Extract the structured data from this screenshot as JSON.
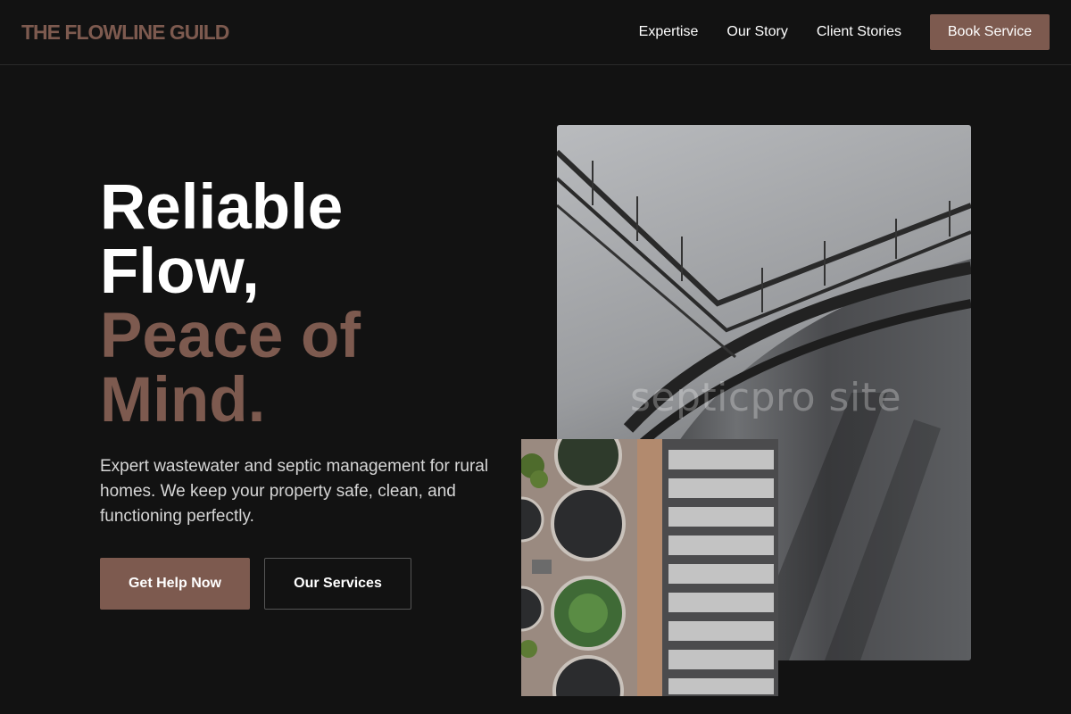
{
  "brand": {
    "logo_text": "THE FLOWLINE GUILD",
    "accent_color": "#7d5a4f"
  },
  "nav": {
    "items": [
      {
        "label": "Expertise"
      },
      {
        "label": "Our Story"
      },
      {
        "label": "Client Stories"
      }
    ],
    "cta_label": "Book Service"
  },
  "hero": {
    "title_line1": "Reliable",
    "title_line2": "Flow,",
    "title_line3": "Peace of",
    "title_line4": "Mind.",
    "description": "Expert wastewater and septic management for rural homes. We keep your property safe, clean, and functioning perfectly.",
    "primary_button": "Get Help Now",
    "secondary_button": "Our Services"
  },
  "images": {
    "main_watermark": "septicpro site"
  }
}
